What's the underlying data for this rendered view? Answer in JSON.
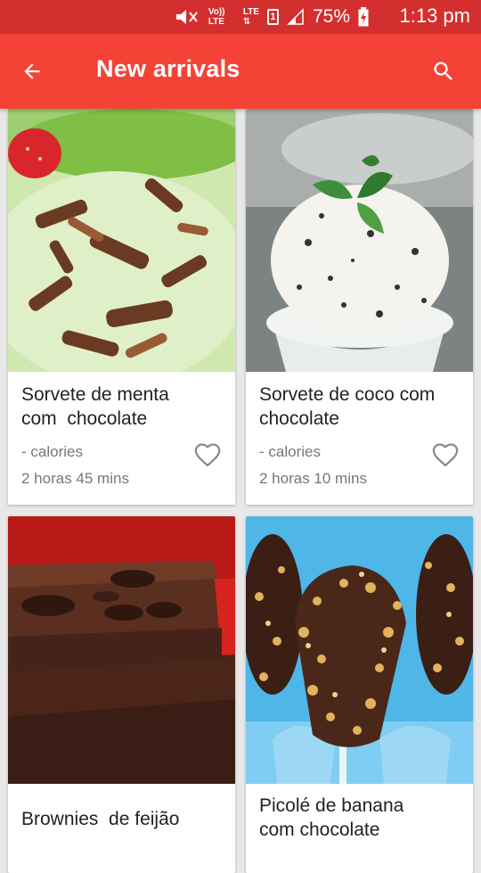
{
  "status_bar": {
    "volte": "Vo)) LTE",
    "lte": "LTE",
    "sim_slot": "1",
    "battery": "75%",
    "time": "1:13 pm"
  },
  "app_bar": {
    "title": "New arrivals",
    "back_icon": "arrow-back-icon",
    "search_icon": "search-icon"
  },
  "colors": {
    "status_bar": "#d32f2f",
    "app_bar": "#f44336",
    "background": "#e8e8e8"
  },
  "recipes": [
    {
      "name": "Sorvete de menta\ncom  chocolate",
      "calories": "- calories",
      "time": "2 horas 45 mins",
      "image": "mint ice cream with chocolate shavings"
    },
    {
      "name": "Sorvete de coco com\nchocolate",
      "calories": "- calories",
      "time": "2 horas 10 mins",
      "image": "coconut ice cream scoop with mint leaf"
    },
    {
      "name": "Brownies  de feijão",
      "image": "stacked brownies"
    },
    {
      "name": "Picolé de banana\ncom chocolate",
      "image": "chocolate banana pops with nuts"
    }
  ]
}
